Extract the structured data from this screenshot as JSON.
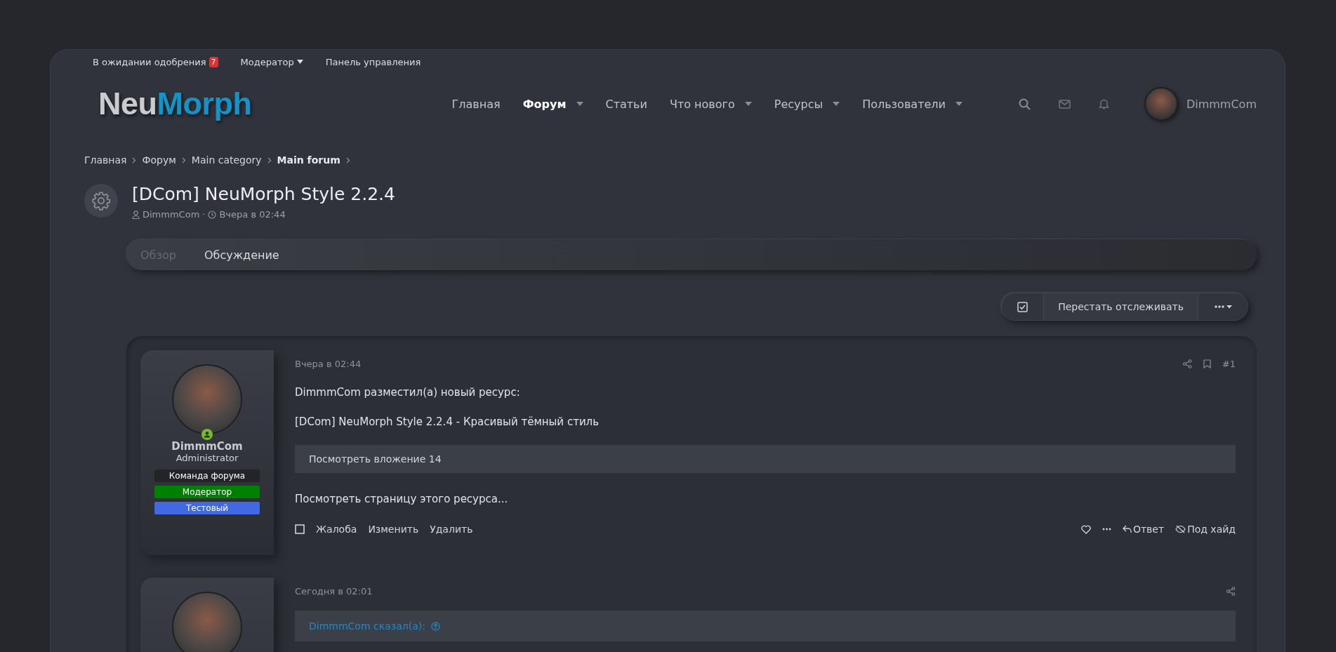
{
  "top_links": [
    {
      "label": "В ожидании одобрения",
      "badge": "7",
      "dropdown": false
    },
    {
      "label": "Модератор",
      "dropdown": true
    },
    {
      "label": "Панель управления",
      "dropdown": false
    }
  ],
  "logo": {
    "first": "Neu",
    "second": "Morph"
  },
  "nav": [
    {
      "label": "Главная",
      "selected": false,
      "dropdown": false
    },
    {
      "label": "Форум",
      "selected": true,
      "dropdown": true
    },
    {
      "label": "Статьи",
      "selected": false,
      "dropdown": false
    },
    {
      "label": "Что нового",
      "selected": false,
      "dropdown": true
    },
    {
      "label": "Ресурсы",
      "selected": false,
      "dropdown": true
    },
    {
      "label": "Пользователи",
      "selected": false,
      "dropdown": true
    }
  ],
  "header_user": {
    "name": "DimmmCom"
  },
  "breadcrumbs": [
    {
      "label": "Главная",
      "current": false
    },
    {
      "label": "Форум",
      "current": false
    },
    {
      "label": "Main category",
      "current": false
    },
    {
      "label": "Main forum",
      "current": true
    }
  ],
  "thread": {
    "title": "[DCom] NeuMorph Style 2.2.4",
    "author": "DimmmCom",
    "separator": "·",
    "date": "Вчера в 02:44"
  },
  "tabs": [
    {
      "label": "Обзор",
      "selected": false
    },
    {
      "label": "Обсуждение",
      "selected": true
    }
  ],
  "watch_button": {
    "label": "Перестать отслеживать"
  },
  "posts": [
    {
      "date": "Вчера в 02:44",
      "number": "#1",
      "user": {
        "name": "DimmmCom",
        "title": "Administrator",
        "online": true,
        "banners": [
          {
            "label": "Команда форума",
            "color": "#232428"
          },
          {
            "label": "Модератор",
            "color": "#008000"
          },
          {
            "label": "Тестовый",
            "color": "#4169e1"
          }
        ]
      },
      "paragraphs": [
        "DimmmCom разместил(а) новый ресурс:",
        "[DCom] NeuMorph Style 2.2.4 - Красивый тёмный стиль"
      ],
      "attachment": "Посмотреть вложение 14",
      "link": "Посмотреть страницу этого ресурса...",
      "actions": [
        "Жалоба",
        "Изменить",
        "Удалить"
      ],
      "reply_actions": [
        "Ответ",
        "Под хайд"
      ]
    },
    {
      "date": "Сегодня в 02:01",
      "quote_author": "DimmmCom сказал(а):"
    }
  ]
}
